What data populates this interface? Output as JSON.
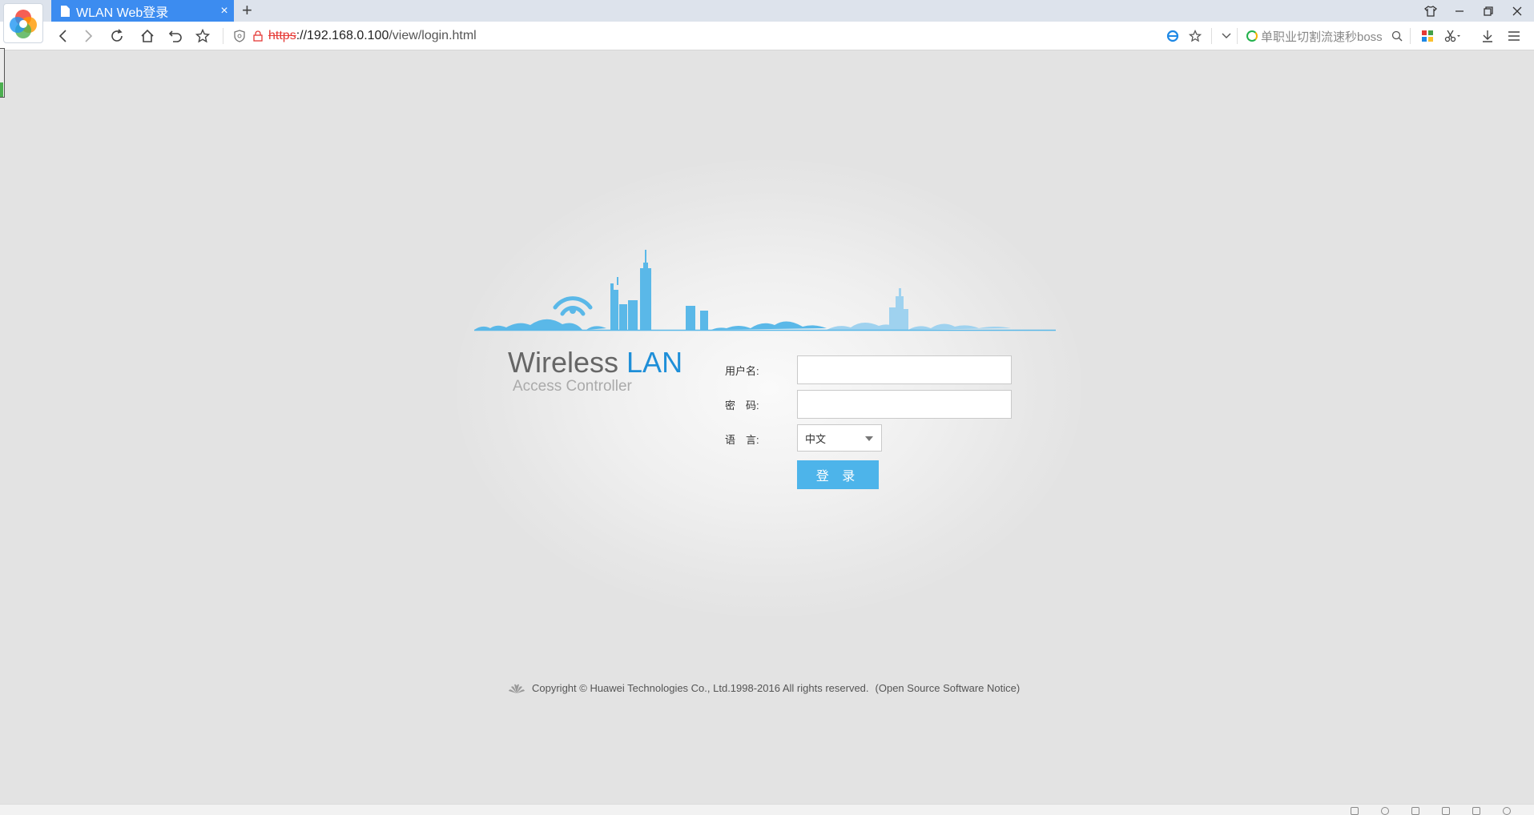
{
  "browser": {
    "tab": {
      "title": "WLAN Web登录",
      "close": "×"
    },
    "new_tab": "+",
    "address": {
      "scheme": "https",
      "sep": "://",
      "host": "192.168.0.100",
      "path": "/view/login.html"
    },
    "search": {
      "text": "单职业切割流速秒boss"
    }
  },
  "page": {
    "brand": {
      "wireless": "Wireless",
      "lan": "LAN",
      "subtitle": "Access Controller"
    },
    "form": {
      "username_label": "用户名:",
      "password_label": "密　码:",
      "language_label": "语　言:",
      "language_value": "中文",
      "login_button": "登 录",
      "username_value": "",
      "password_value": ""
    },
    "footer": {
      "copyright": "Copyright © Huawei Technologies Co., Ltd.1998-2016 All rights reserved.",
      "oss_notice": "(Open Source Software Notice)"
    }
  },
  "colors": {
    "accent": "#4db4ea",
    "brand_blue": "#1f8fd8",
    "skyline": "#5ab8e8",
    "tab_blue": "#3c8cf0"
  }
}
